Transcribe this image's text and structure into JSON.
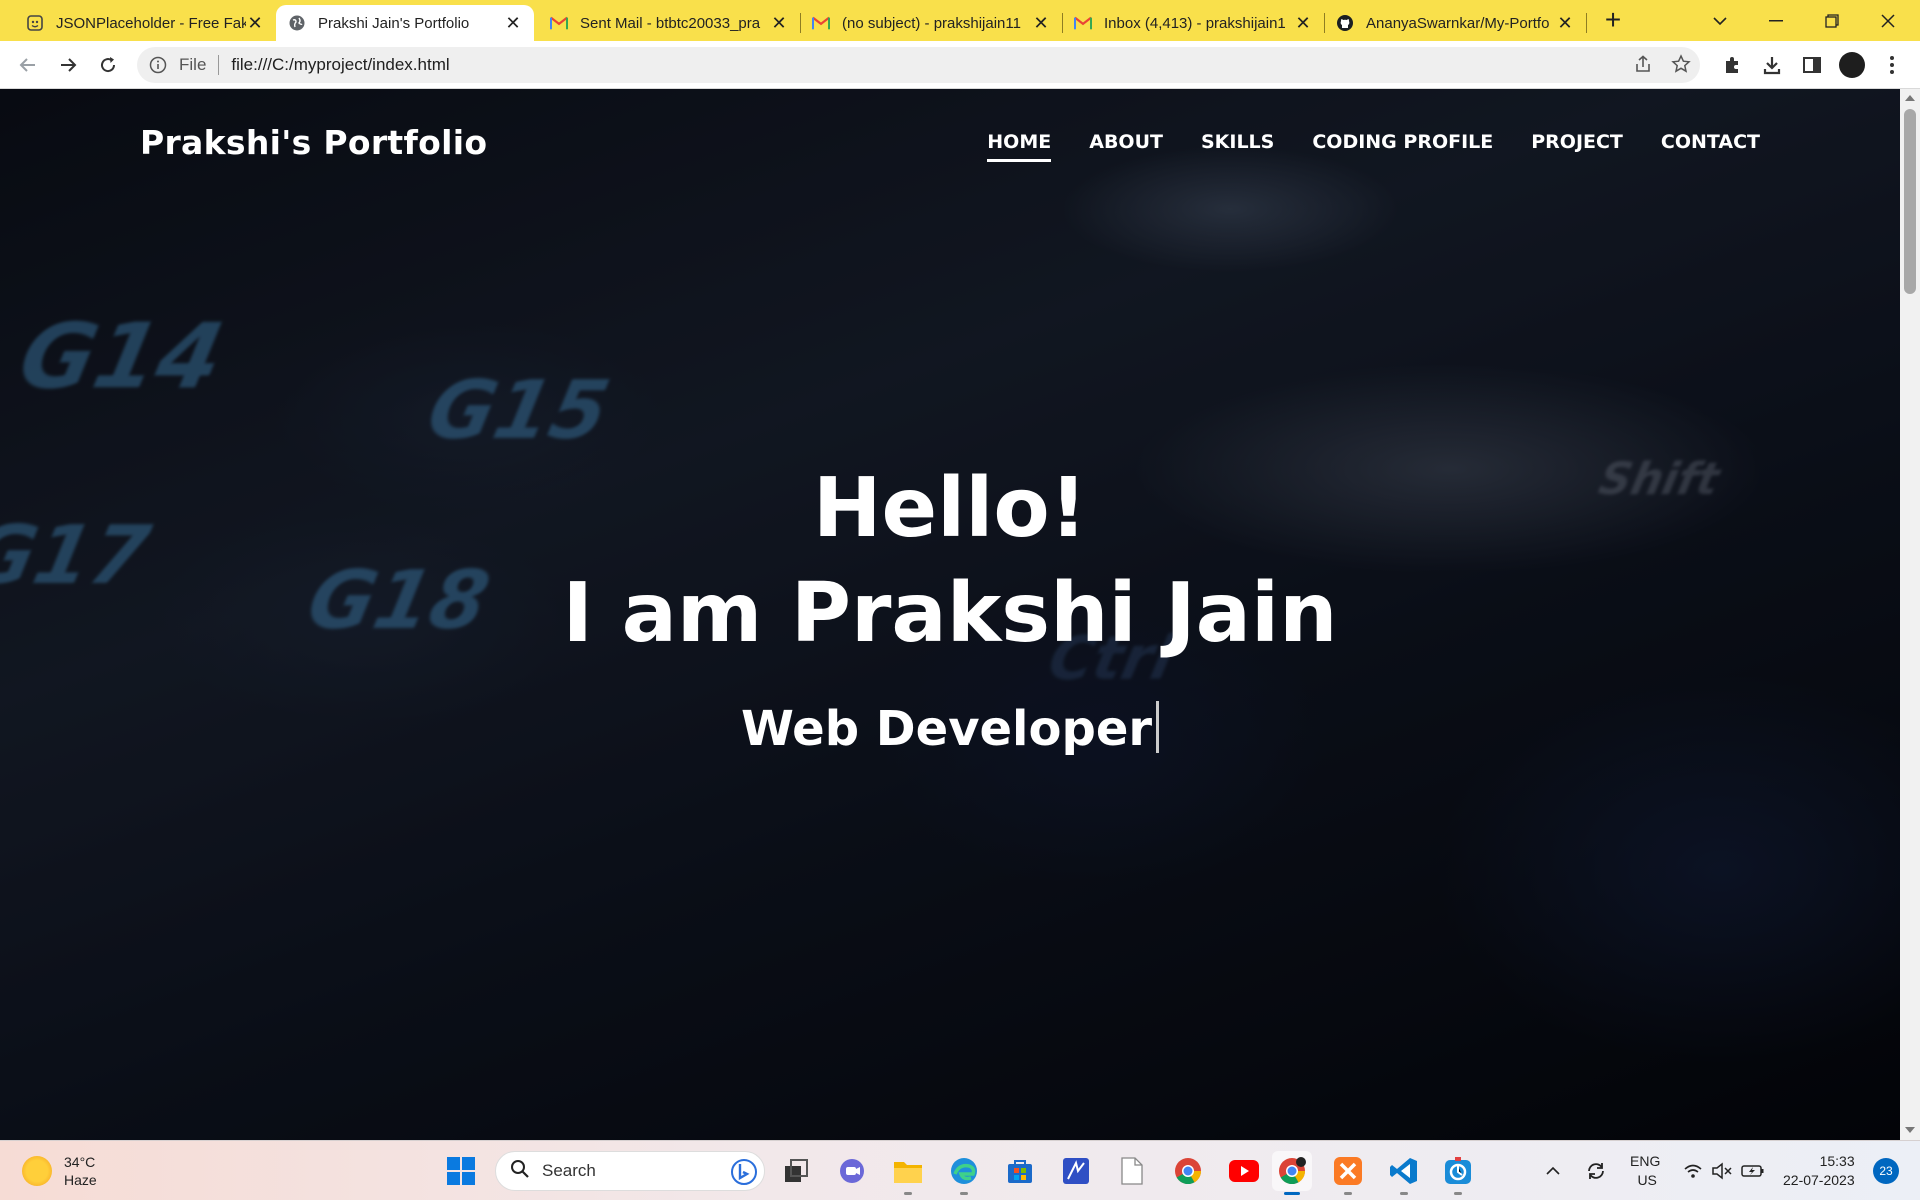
{
  "browser": {
    "tabs": [
      {
        "title": "JSONPlaceholder - Free Fak",
        "icon": "jsonplaceholder-icon"
      },
      {
        "title": "Prakshi Jain's Portfolio",
        "icon": "globe-icon",
        "active": true
      },
      {
        "title": "Sent Mail - btbtc20033_pra",
        "icon": "gmail-icon"
      },
      {
        "title": "(no subject) - prakshijain11",
        "icon": "gmail-icon"
      },
      {
        "title": "Inbox (4,413) - prakshijain1",
        "icon": "gmail-icon"
      },
      {
        "title": "AnanyaSwarnkar/My-Portfo",
        "icon": "github-icon"
      }
    ],
    "address": {
      "scheme_label": "File",
      "url": "file:///C:/myproject/index.html"
    }
  },
  "page": {
    "logo": "Prakshi's Portfolio",
    "nav": [
      {
        "label": "HOME",
        "active": true
      },
      {
        "label": "ABOUT"
      },
      {
        "label": "SKILLS"
      },
      {
        "label": "CODING PROFILE"
      },
      {
        "label": "PROJECT"
      },
      {
        "label": "CONTACT"
      }
    ],
    "hero": {
      "greeting": "Hello!",
      "name_line": "I am Prakshi Jain",
      "role": "Web Developer"
    },
    "background_keys": [
      "G14",
      "G15",
      "G18",
      "G17",
      "Ctrl",
      "Shift"
    ]
  },
  "taskbar": {
    "weather": {
      "temp": "34°C",
      "condition": "Haze"
    },
    "search_placeholder": "Search",
    "language": {
      "line1": "ENG",
      "line2": "US"
    },
    "time": "15:33",
    "date": "22-07-2023",
    "notifications": "23"
  },
  "colors": {
    "tabstrip": "#f9e04b",
    "accent": "#0067c0"
  }
}
